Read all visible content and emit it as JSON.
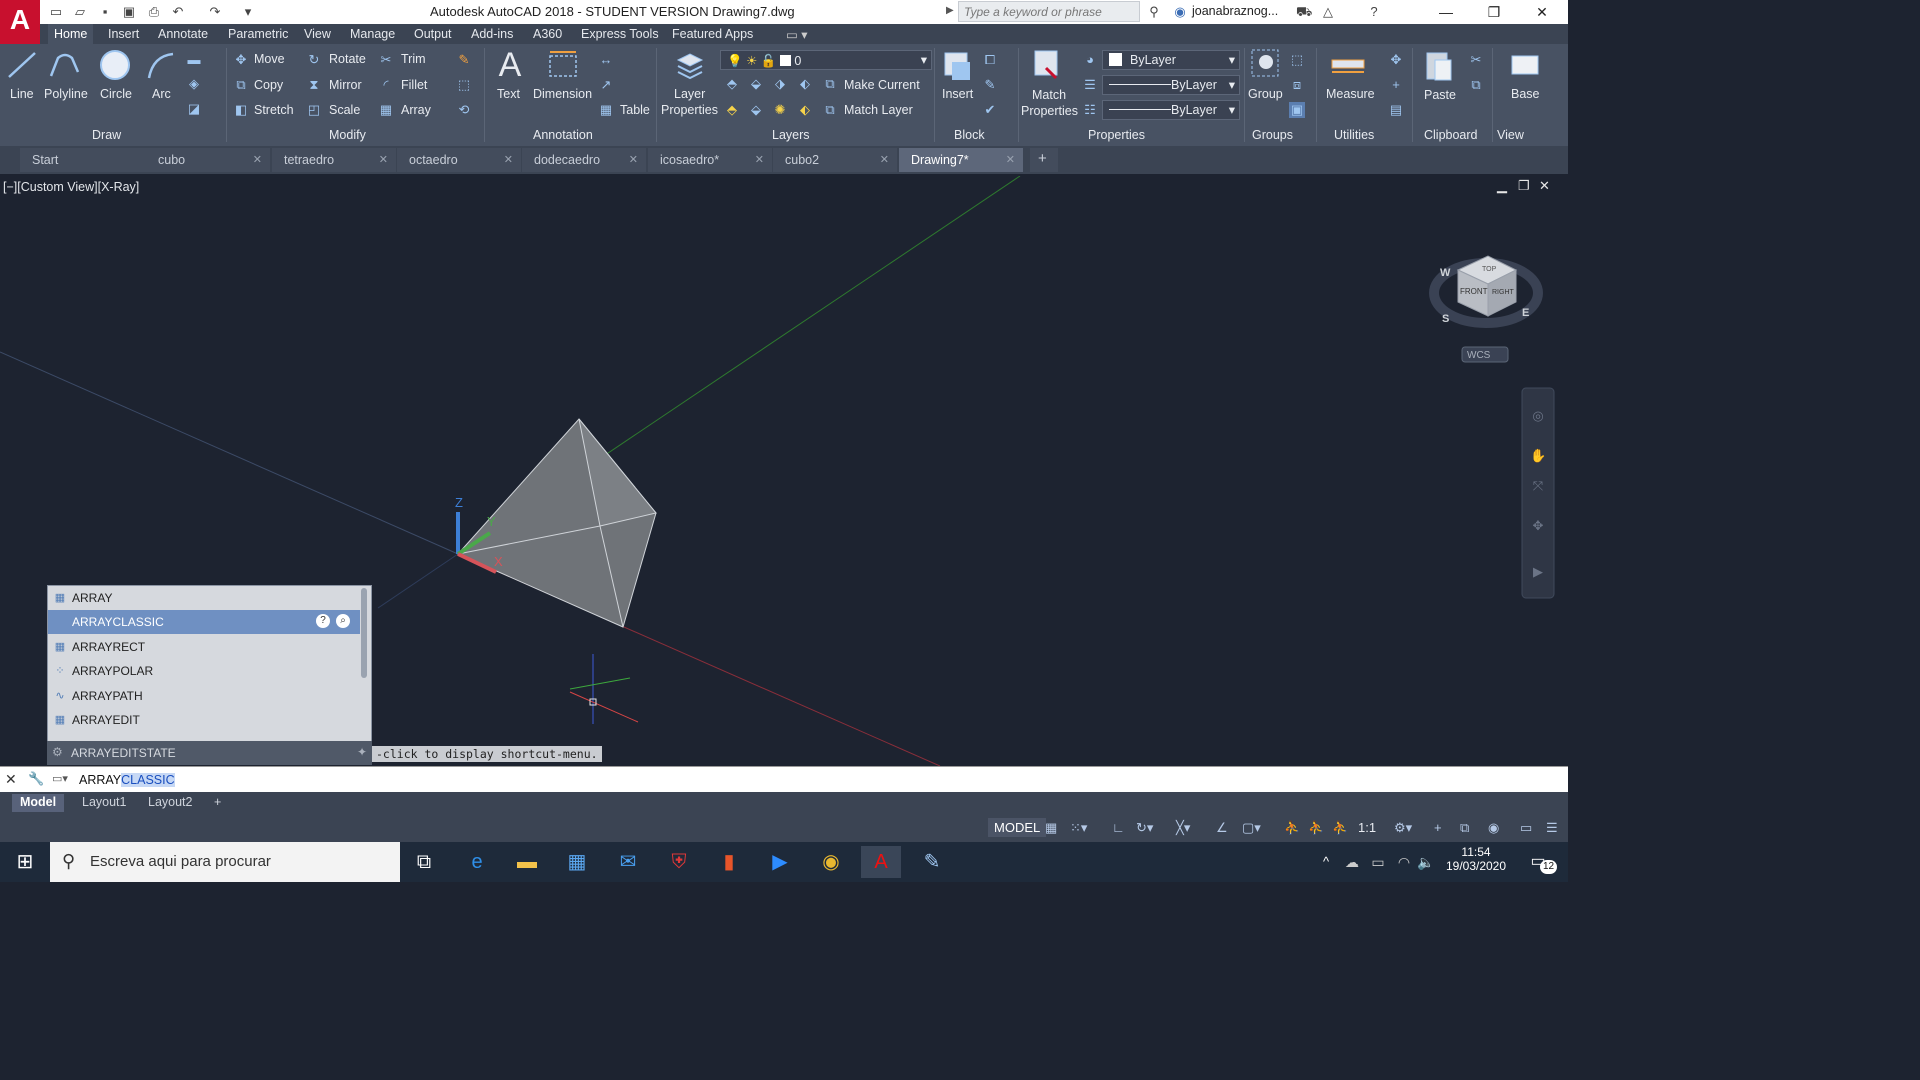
{
  "window": {
    "title": "Autodesk AutoCAD 2018 - STUDENT VERSION    Drawing7.dwg",
    "search_placeholder": "Type a keyword or phrase",
    "user": "joanabraznog...",
    "app_logo": "A"
  },
  "menu_tabs": [
    "Home",
    "Insert",
    "Annotate",
    "Parametric",
    "View",
    "Manage",
    "Output",
    "Add-ins",
    "A360",
    "Express Tools",
    "Featured Apps"
  ],
  "ribbon": {
    "draw": {
      "line": "Line",
      "polyline": "Polyline",
      "circle": "Circle",
      "arc": "Arc",
      "title": "Draw"
    },
    "modify": {
      "move": "Move",
      "rotate": "Rotate",
      "trim": "Trim",
      "copy": "Copy",
      "mirror": "Mirror",
      "fillet": "Fillet",
      "stretch": "Stretch",
      "scale": "Scale",
      "array": "Array",
      "title": "Modify"
    },
    "annotation": {
      "text": "Text",
      "dimension": "Dimension",
      "table": "Table",
      "title": "Annotation"
    },
    "layers": {
      "layer_properties_1": "Layer",
      "layer_properties_2": "Properties",
      "current_layer": "0",
      "make_current": "Make Current",
      "match_layer": "Match Layer",
      "title": "Layers"
    },
    "block": {
      "insert": "Insert",
      "title": "Block"
    },
    "properties": {
      "match_1": "Match",
      "match_2": "Properties",
      "color": "ByLayer",
      "linetype": "ByLayer",
      "lineweight": "ByLayer",
      "title": "Properties"
    },
    "groups": {
      "group": "Group",
      "title": "Groups"
    },
    "utilities": {
      "measure": "Measure",
      "title": "Utilities"
    },
    "clipboard": {
      "paste": "Paste",
      "title": "Clipboard"
    },
    "view": {
      "base": "Base",
      "title": "View"
    }
  },
  "file_tabs": [
    "Start",
    "cubo",
    "tetraedro",
    "octaedro",
    "dodecaedro",
    "icosaedro*",
    "cubo2",
    "Drawing7*"
  ],
  "viewport": {
    "label": "[−][Custom View][X-Ray]",
    "viewcube": {
      "top": "TOP",
      "front": "FRONT",
      "right": "RIGHT",
      "w": "W",
      "s": "S",
      "e": "E",
      "wcs": "WCS"
    },
    "ucs": {
      "x": "X",
      "y": "Y",
      "z": "Z"
    }
  },
  "autocomplete": {
    "items": [
      "ARRAY",
      "ARRAYCLASSIC",
      "ARRAYRECT",
      "ARRAYPOLAR",
      "ARRAYPATH",
      "ARRAYEDIT"
    ],
    "selected_index": 1,
    "footer": "ARRAYEDITSTATE",
    "hint": "-click to display shortcut-menu."
  },
  "command_line": {
    "typed": "ARRAY",
    "suggested": "CLASSIC"
  },
  "layout_tabs": [
    "Model",
    "Layout1",
    "Layout2"
  ],
  "status_bar": {
    "model": "MODEL",
    "scale": "1:1"
  },
  "taskbar": {
    "search_placeholder": "Escreva aqui para procurar",
    "time": "11:54",
    "date": "19/03/2020",
    "notifications": "12"
  }
}
